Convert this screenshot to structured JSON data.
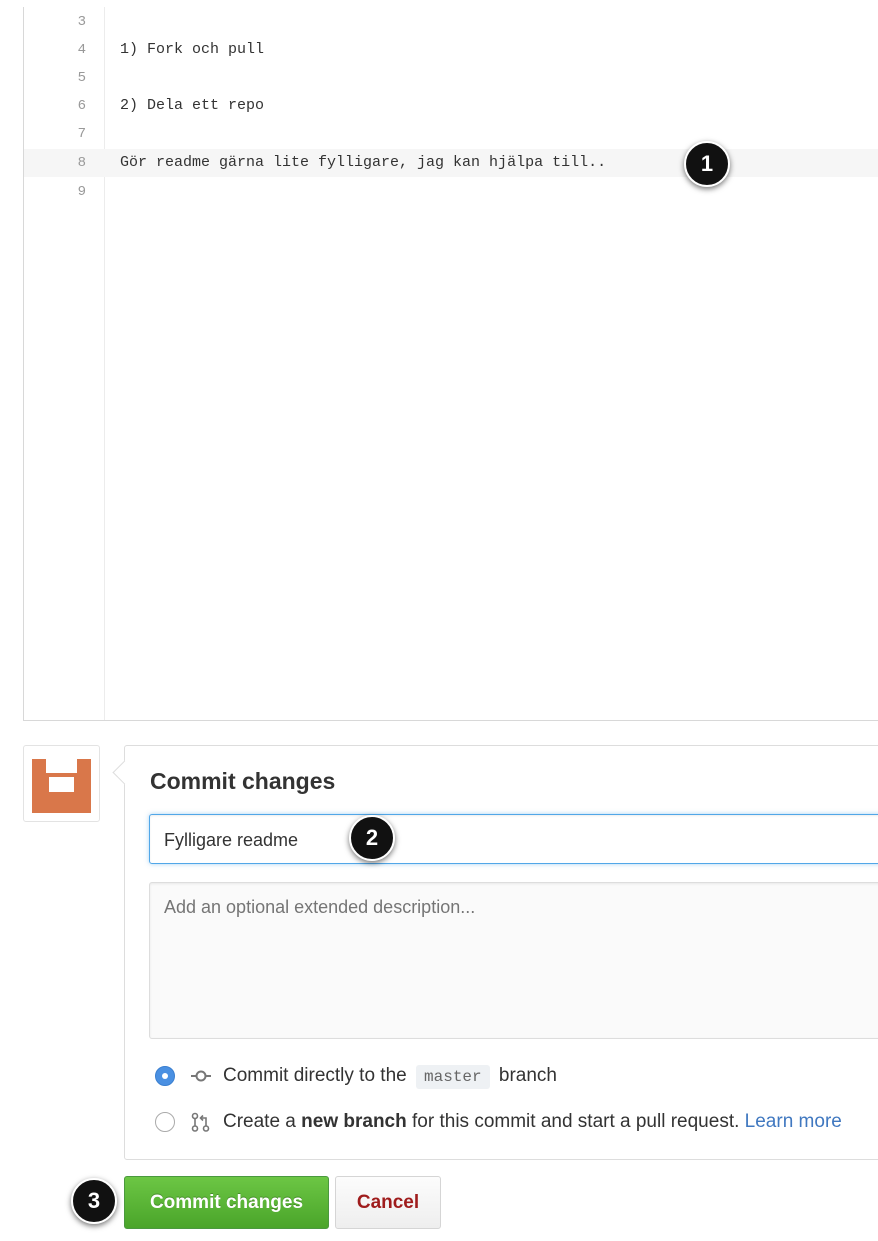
{
  "editor": {
    "lines": [
      {
        "num": "3",
        "text": ""
      },
      {
        "num": "4",
        "text": "1) Fork och pull"
      },
      {
        "num": "5",
        "text": ""
      },
      {
        "num": "6",
        "text": "2) Dela ett repo"
      },
      {
        "num": "7",
        "text": ""
      },
      {
        "num": "8",
        "text": "Gör readme gärna lite fylligare, jag kan hjälpa till.."
      },
      {
        "num": "9",
        "text": ""
      }
    ]
  },
  "markers": [
    "1",
    "2",
    "3"
  ],
  "commit": {
    "title": "Commit changes",
    "summary_value": "Fylligare readme",
    "description_placeholder": "Add an optional extended description...",
    "option_direct": {
      "prefix": "Commit directly to the",
      "branch": "master",
      "suffix": "branch"
    },
    "option_new": {
      "prefix": "Create a",
      "bold": "new branch",
      "suffix": "for this commit and start a pull request.",
      "link": "Learn more"
    }
  },
  "buttons": {
    "commit_label": "Commit changes",
    "cancel_label": "Cancel"
  },
  "colors": {
    "avatar": "#d9774a",
    "primary_button": "#5cb83a",
    "cancel_text": "#9f1c1c",
    "link": "#4078c0",
    "radio_checked": "#4a90e2"
  },
  "icons": {
    "avatar": "identicon-avatar",
    "commit": "git-commit-icon",
    "pull_request": "git-pull-request-icon"
  }
}
